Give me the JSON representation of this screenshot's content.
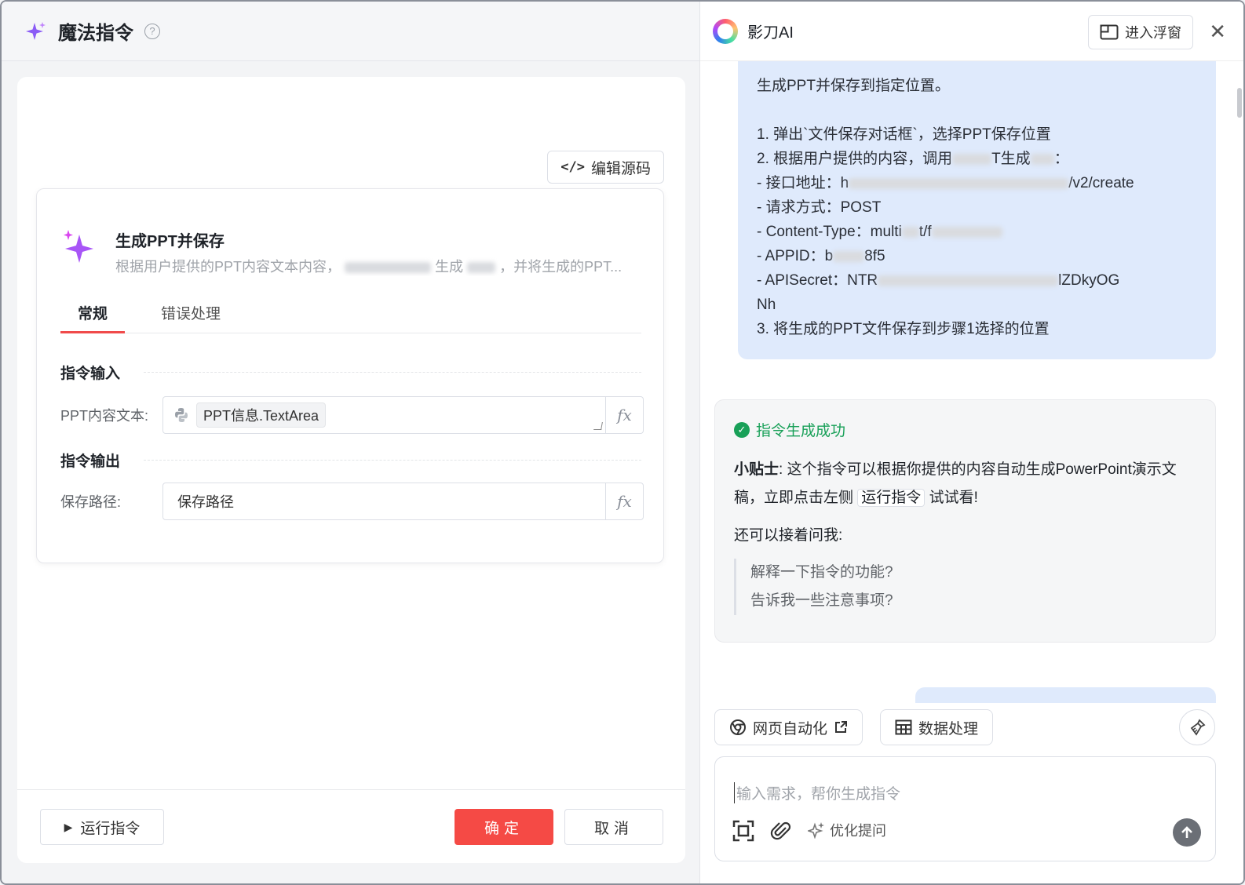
{
  "left": {
    "title": "魔法指令",
    "help_icon": "?",
    "edit_source_label": "编辑源码",
    "command": {
      "title": "生成PPT并保存",
      "desc_prefix": "根据用户提供的PPT内容文本内容，",
      "desc_mid": "生成",
      "desc_suffix": "，并将生成的PPT..."
    },
    "tabs": [
      "常规",
      "错误处理"
    ],
    "input_section": "指令输入",
    "output_section": "指令输出",
    "ppt_label": "PPT内容文本:",
    "ppt_value": "PPT信息.TextArea",
    "save_label": "保存路径:",
    "save_value": "保存路径",
    "fx": "fx",
    "run_label": "运行指令",
    "ok_label": "确定",
    "cancel_label": "取消"
  },
  "right": {
    "brand": "影刀AI",
    "float_label": "进入浮窗",
    "user_message": [
      "生成PPT并保存到指定位置。",
      "",
      "1. 弹出`文件保存对话框`，选择PPT保存位置",
      "2. 根据用户提供的内容，调用",
      "  - 接口地址：h",
      "  - 请求方式：POST",
      "  - Content-Type：multi",
      "  - APPID：b",
      "  - APISecret：NTR",
      "Nh",
      "3. 将生成的PPT文件保存到步骤1选择的位置"
    ],
    "msg_frag": {
      "line4_mid": "T生成",
      "line5_tail": "/v2/create",
      "line7_tail": "t/f",
      "line8_tail": "8f5",
      "line9_tail": "lZDkyOG"
    },
    "success": "指令生成成功",
    "tip_label": "小贴士",
    "tip_text1": ": 这个指令可以根据你提供的内容自动生成PowerPoint演示文稿，立即点击左侧",
    "tip_chip": "运行指令",
    "tip_text2": "试试看!",
    "follow": "还可以接着问我:",
    "suggestions": [
      "解释一下指令的功能?",
      "告诉我一些注意事项?"
    ],
    "chip_web": "网页自动化",
    "chip_data": "数据处理",
    "input_placeholder": "输入需求，帮你生成指令",
    "optimize_label": "优化提问"
  },
  "colors": {
    "accent_red": "#f54a45",
    "success_green": "#18a058",
    "bubble_blue": "#dfeafc",
    "sparkle_purple": "#9b5cf6"
  }
}
